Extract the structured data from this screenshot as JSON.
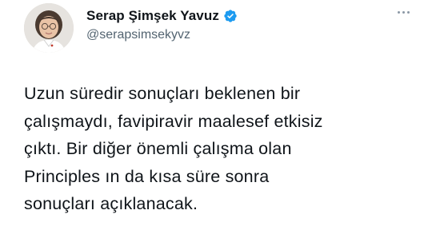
{
  "tweet": {
    "author_name": "Serap Şimşek Yavuz",
    "author_handle": "@serapsimsekyvz",
    "verified_icon": "verified-badge-icon",
    "more_icon": "more-options-icon",
    "body": "Uzun süredir sonuçları beklenen bir\nçalışmaydı, favipiravir maalesef etkisiz\nçıktı. Bir diğer önemli çalışma olan\nPrinciples ın da kısa süre sonra\nsonuçları açıklanacak."
  },
  "colors": {
    "text": "#0f1419",
    "secondary": "#536471",
    "verified": "#1d9bf0",
    "background": "#ffffff"
  }
}
